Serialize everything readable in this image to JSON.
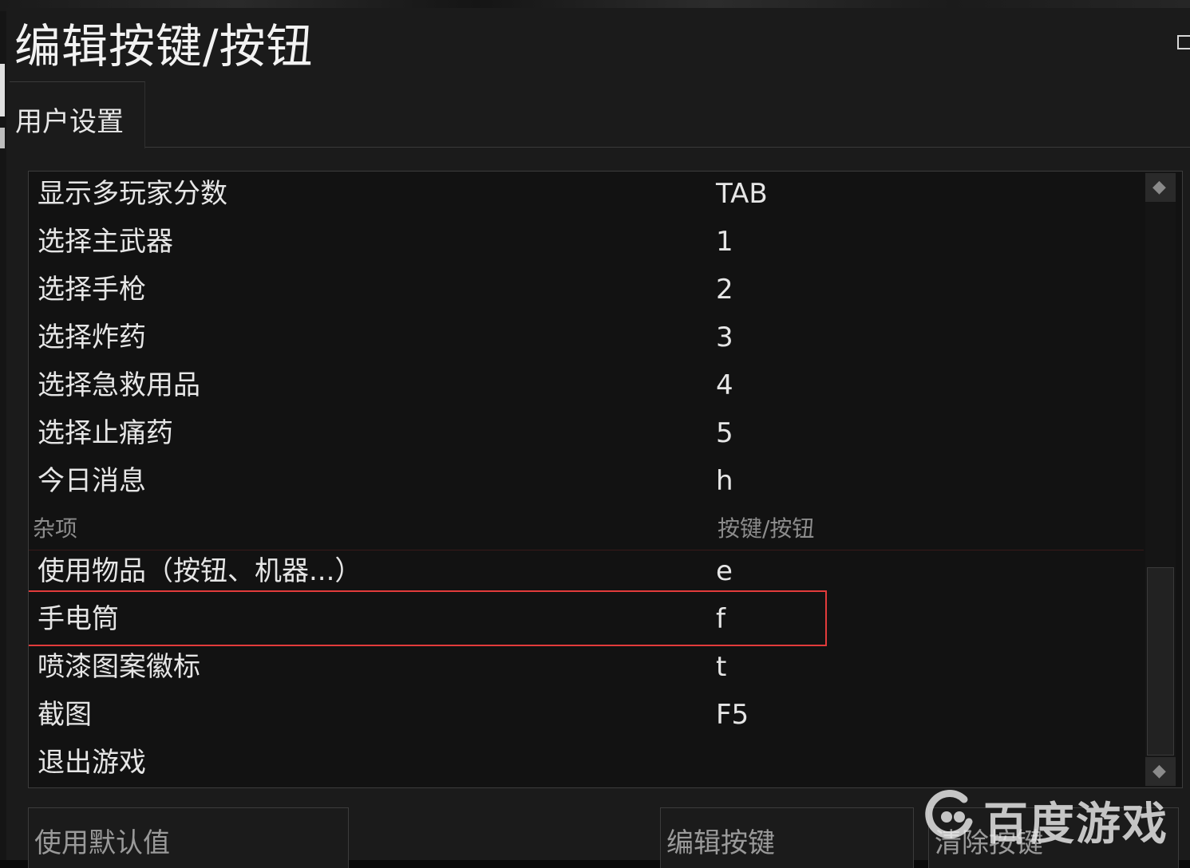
{
  "window": {
    "title": "编辑按键/按钮",
    "tab_label": "用户设置"
  },
  "rows": [
    {
      "action": "显示多玩家分数",
      "key": "TAB"
    },
    {
      "action": "选择主武器",
      "key": "1"
    },
    {
      "action": "选择手枪",
      "key": "2"
    },
    {
      "action": "选择炸药",
      "key": "3"
    },
    {
      "action": "选择急救用品",
      "key": "4"
    },
    {
      "action": "选择止痛药",
      "key": "5"
    },
    {
      "action": "今日消息",
      "key": "h"
    }
  ],
  "section": {
    "label": "杂项",
    "key_header": "按键/按钮"
  },
  "misc_rows": [
    {
      "action": "使用物品（按钮、机器...）",
      "key": "e"
    },
    {
      "action": "手电筒",
      "key": "f"
    },
    {
      "action": "喷漆图案徽标",
      "key": "t"
    },
    {
      "action": "截图",
      "key": "F5"
    },
    {
      "action": "退出游戏",
      "key": ""
    }
  ],
  "buttons": {
    "use_defaults": "使用默认值",
    "edit_key": "编辑按键",
    "clear_key": "清除按键"
  },
  "watermark": {
    "text": "百度游戏"
  },
  "colors": {
    "highlight": "#e23b3b",
    "background": "#1b1b1b",
    "list_bg": "#121212"
  },
  "icons": {
    "scroll_up": "diamond-arrow-up-icon",
    "scroll_down": "diamond-arrow-down-icon",
    "window_restore": "window-restore-icon"
  }
}
